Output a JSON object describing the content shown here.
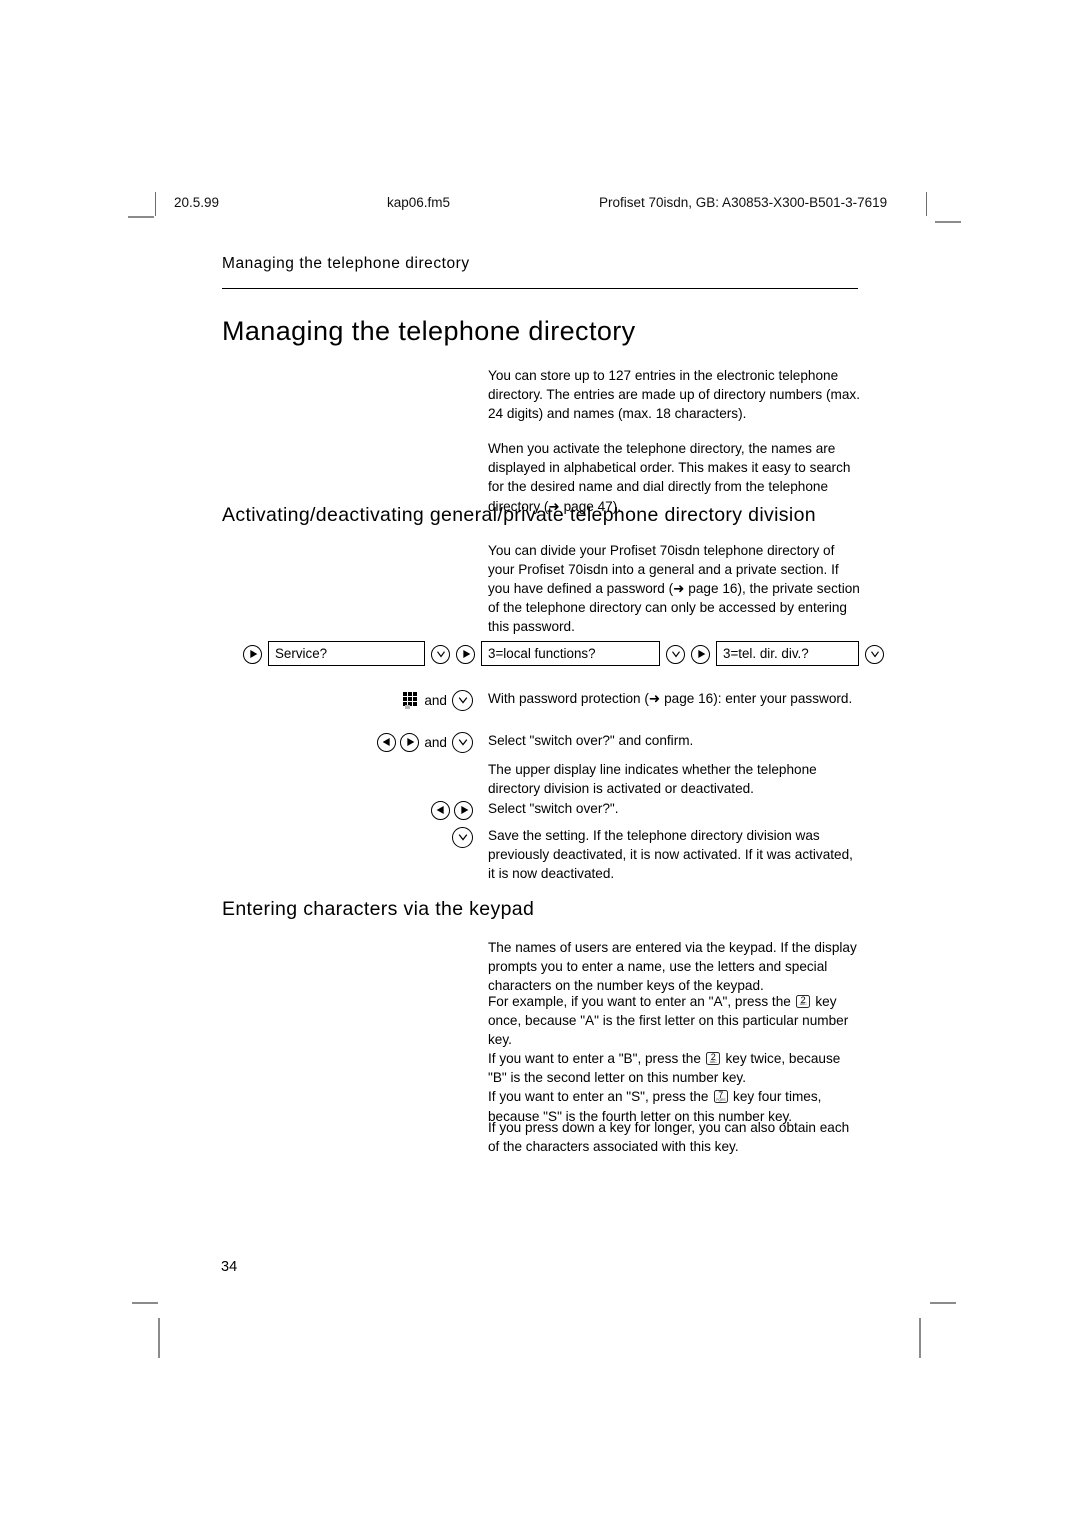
{
  "header": {
    "date": "20.5.99",
    "filename": "kap06.fm5",
    "document_id": "Profiset 70isdn, GB: A30853-X300-B501-3-7619"
  },
  "running_head": "Managing the telephone directory",
  "page_title": "Managing the telephone directory",
  "page_number": "34",
  "intro": {
    "paragraph_1": "You can store up to 127 entries in the electronic telephone directory. The entries are made up of directory numbers (max. 24 digits) and names (max. 18 characters).",
    "paragraph_2": "When you activate the telephone directory, the names are displayed in alphabetical order. This makes it easy to search for the desired name and dial directly from the telephone directory (➜ page 47)."
  },
  "section_division": {
    "heading": "Activating/deactivating general/private telephone directory division",
    "paragraph": "You can divide your Profiset 70isdn telephone directory of your Profiset 70isdn into a general and a private section. If you have defined a password (➜ page 16), the private section of the telephone directory can only be accessed by entering this password.",
    "sequence": [
      {
        "icon": "right-arrow-key-icon",
        "box_label": "Service?",
        "confirm_icon": "confirm-key-icon"
      },
      {
        "icon": "right-arrow-key-icon",
        "box_label": "3=local functions?",
        "confirm_icon": "confirm-key-icon"
      },
      {
        "icon": "right-arrow-key-icon",
        "box_label": "3=tel. dir. div.?",
        "confirm_icon": "confirm-key-icon"
      }
    ],
    "steps": [
      {
        "icons": [
          "keypad-icon",
          "confirm-key-icon"
        ],
        "conjunction": "and",
        "text": "With password protection (➜ page 16): enter your password."
      },
      {
        "icons": [
          "left-arrow-key-icon",
          "right-arrow-key-icon",
          "confirm-key-icon"
        ],
        "conjunction": "and",
        "text": "Select \"switch over?\" and confirm."
      },
      {
        "icons": [],
        "conjunction": "",
        "text": "The upper display line indicates whether the telephone directory division is activated or deactivated."
      },
      {
        "icons": [
          "left-arrow-key-icon",
          "right-arrow-key-icon"
        ],
        "conjunction": "",
        "text": "Select \"switch over?\"."
      },
      {
        "icons": [
          "confirm-key-icon"
        ],
        "conjunction": "",
        "text": "Save the setting. If the telephone directory division was previously deactivated, it is now activated. If it was activated, it is now deactivated."
      }
    ]
  },
  "section_keypad": {
    "heading": "Entering characters via the keypad",
    "paragraph_1": "The names of users are entered via the keypad. If the display prompts you to enter a name, use the letters and special characters on the number keys of the keypad.",
    "example_a_before": "For example, if you want to enter an \"A\", press the ",
    "example_a_key": "2",
    "example_a_key_letters": "ABC",
    "example_a_after": " key once, because \"A\" is the first letter on this particular number key.",
    "example_b_before": "If you want to enter a \"B\", press the ",
    "example_b_key": "2",
    "example_b_key_letters": "ABC",
    "example_b_after": " key twice, because \"B\" is the second letter on this number key.",
    "example_s_before": "If you want to enter an \"S\", press the ",
    "example_s_key": "7",
    "example_s_key_letters": "PQRS",
    "example_s_after": " key four times, because \"S\" is the fourth letter on this number key.",
    "paragraph_long_press": "If you press down a key for longer, you can also obtain each of the characters associated with this key."
  },
  "colors": {
    "text": "#000000",
    "page_background": "#ffffff",
    "crop_mark": "#8b8b8b",
    "rule": "#000000"
  }
}
